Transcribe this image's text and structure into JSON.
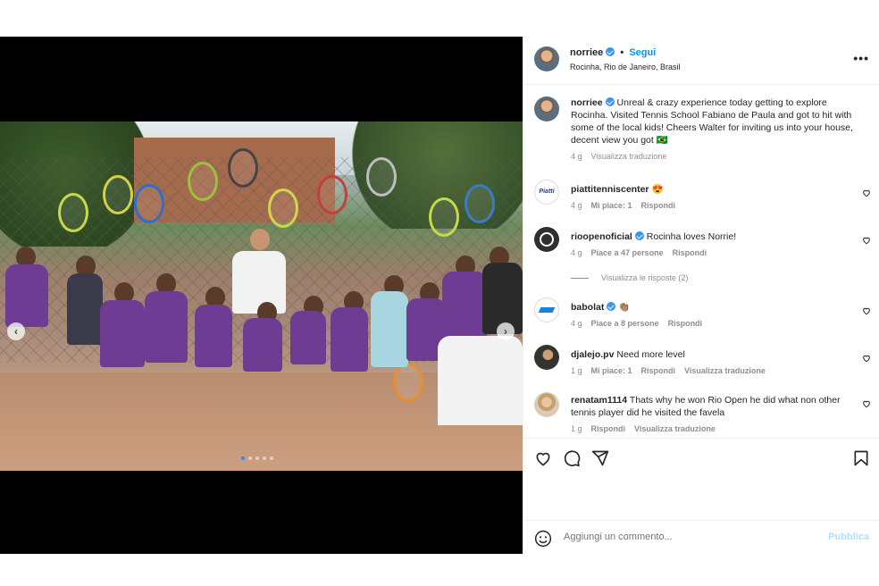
{
  "post": {
    "username": "norriee",
    "separator": "•",
    "follow_label": "Segui",
    "location": "Rocinha, Rio de Janeiro, Brasil",
    "more_label": "•••"
  },
  "caption": {
    "username": "norriee",
    "text": "Unreal & crazy experience today getting to explore Rocinha. Visited Tennis School Fabiano de Paula and got to hit with some of the local kids! Cheers Walter for inviting us into your house, decent view you got 🇧🇷",
    "time": "4 g",
    "translate": "Visualizza traduzione"
  },
  "comments": [
    {
      "username": "piattitenniscenter",
      "verified": false,
      "text": "😍",
      "time": "4 g",
      "likes": "Mi piace: 1",
      "reply": "Rispondi",
      "avatar_text": "Piatti"
    },
    {
      "username": "rioopenoficial",
      "verified": true,
      "text": "Rocinha loves Norrie!",
      "time": "4 g",
      "likes": "Piace a 47 persone",
      "reply": "Rispondi",
      "view_replies": "Visualizza le risposte (2)"
    },
    {
      "username": "babolat",
      "verified": true,
      "text": "👏🏽",
      "time": "4 g",
      "likes": "Piace a 8 persone",
      "reply": "Rispondi"
    },
    {
      "username": "djalejo.pv",
      "verified": false,
      "text": "Need more level",
      "time": "1 g",
      "likes": "Mi piace: 1",
      "reply": "Rispondi",
      "translate": "Visualizza traduzione"
    },
    {
      "username": "renatam1114",
      "verified": false,
      "text": "Thats why he won Rio Open he did what non other tennis player did he visited the favela",
      "time": "1 g",
      "reply": "Rispondi",
      "translate": "Visualizza traduzione"
    }
  ],
  "composer": {
    "placeholder": "Aggiungi un commento...",
    "publish_label": "Pubblica"
  },
  "colors": {
    "accent": "#0095f6",
    "verified": "#3897f0",
    "muted": "#8e8e8e"
  },
  "icons": [
    "heart-icon",
    "comment-icon",
    "share-icon",
    "bookmark-icon",
    "emoji-icon",
    "more-options-icon",
    "chevron-left-icon",
    "chevron-right-icon"
  ]
}
